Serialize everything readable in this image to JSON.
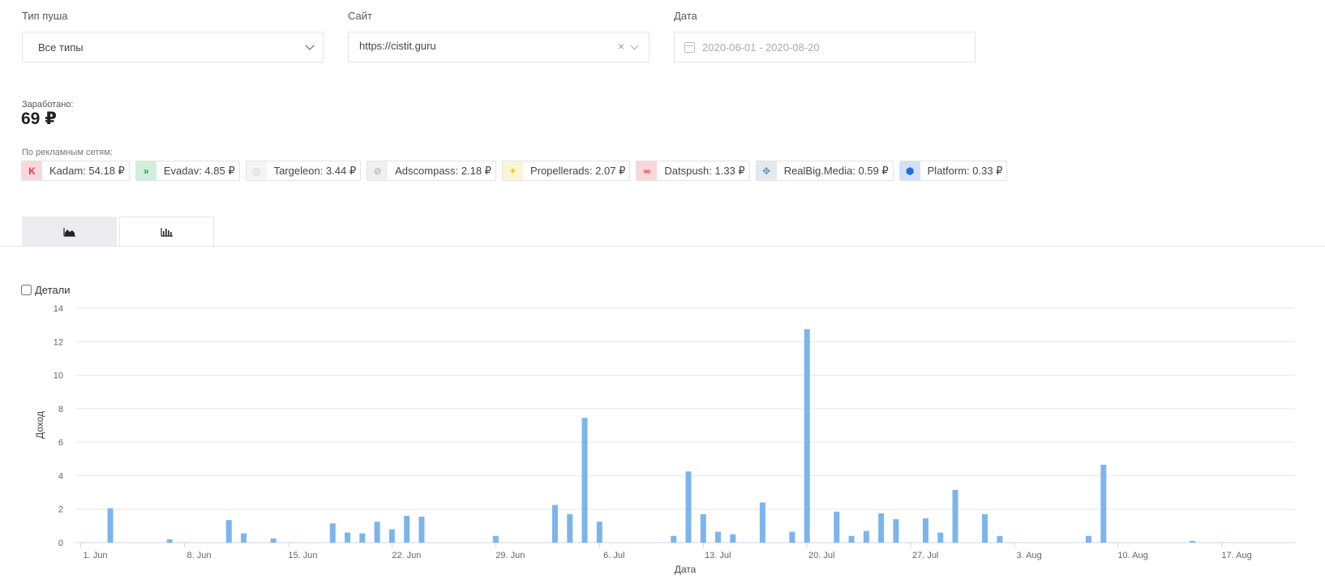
{
  "filters": {
    "push_type": {
      "label": "Тип пуша",
      "value": "Все типы"
    },
    "site": {
      "label": "Сайт",
      "value": "https://cistit.guru",
      "clear": "×"
    },
    "date": {
      "label": "Дата",
      "value": "2020-06-01 - 2020-08-20"
    }
  },
  "summary": {
    "earned_label": "Заработано:",
    "earned_value": "69 ₽",
    "networks_label": "По рекламным сетям:"
  },
  "networks": [
    {
      "name": "Kadam: 54.18 ₽",
      "icon": "kadam-logo-icon",
      "color": "#e03a52",
      "glyph": "K"
    },
    {
      "name": "Evadav: 4.85 ₽",
      "icon": "evadav-logo-icon",
      "color": "#1aa856",
      "glyph": "»"
    },
    {
      "name": "Targeleon: 3.44 ₽",
      "icon": "targeleon-logo-icon",
      "color": "#c9c9c9",
      "glyph": "◎"
    },
    {
      "name": "Adscompass: 2.18 ₽",
      "icon": "adscompass-logo-icon",
      "color": "#b5b5b5",
      "glyph": "⊘"
    },
    {
      "name": "Propellerads: 2.07 ₽",
      "icon": "propellerads-logo-icon",
      "color": "#e5cc2e",
      "glyph": "✦"
    },
    {
      "name": "Datspush: 1.33 ₽",
      "icon": "datspush-logo-icon",
      "color": "#e8344c",
      "glyph": "∞"
    },
    {
      "name": "RealBig.Media: 0.59 ₽",
      "icon": "realbig-logo-icon",
      "color": "#6f8fb0",
      "glyph": "✥"
    },
    {
      "name": "Platform: 0.33 ₽",
      "icon": "platform-logo-icon",
      "color": "#1f6ae0",
      "glyph": "⬢"
    }
  ],
  "tabs": [
    {
      "icon": "area-chart-icon",
      "active": false
    },
    {
      "icon": "bar-chart-icon",
      "active": true
    }
  ],
  "details_label": "Детали",
  "chart_data": {
    "type": "bar",
    "xlabel": "Дата",
    "ylabel": "Доход",
    "ylim": [
      0,
      14
    ],
    "yticks": [
      0,
      2,
      4,
      6,
      8,
      10,
      12,
      14
    ],
    "xticks": [
      "1. Jun",
      "8. Jun",
      "15. Jun",
      "22. Jun",
      "29. Jun",
      "6. Jul",
      "13. Jul",
      "20. Jul",
      "27. Jul",
      "3. Aug",
      "10. Aug",
      "17. Aug"
    ],
    "grid": true,
    "bar_color": "#7cb5ec",
    "x": [
      "2020-06-03",
      "2020-06-07",
      "2020-06-11",
      "2020-06-12",
      "2020-06-14",
      "2020-06-18",
      "2020-06-19",
      "2020-06-20",
      "2020-06-21",
      "2020-06-22",
      "2020-06-23",
      "2020-06-24",
      "2020-06-29",
      "2020-07-03",
      "2020-07-04",
      "2020-07-05",
      "2020-07-06",
      "2020-07-11",
      "2020-07-12",
      "2020-07-13",
      "2020-07-14",
      "2020-07-15",
      "2020-07-17",
      "2020-07-19",
      "2020-07-20",
      "2020-07-22",
      "2020-07-23",
      "2020-07-24",
      "2020-07-25",
      "2020-07-26",
      "2020-07-28",
      "2020-07-29",
      "2020-07-30",
      "2020-08-01",
      "2020-08-02",
      "2020-08-08",
      "2020-08-09",
      "2020-08-15"
    ],
    "values": [
      2.05,
      0.2,
      1.35,
      0.55,
      0.25,
      1.15,
      0.6,
      0.55,
      1.25,
      0.8,
      1.6,
      1.55,
      0.4,
      2.25,
      1.7,
      7.45,
      1.25,
      0.4,
      4.25,
      1.7,
      0.65,
      0.5,
      2.4,
      0.65,
      12.75,
      1.85,
      0.4,
      0.7,
      1.75,
      1.4,
      1.45,
      0.6,
      3.15,
      1.7,
      0.4,
      0.4,
      4.65,
      0.1
    ]
  }
}
